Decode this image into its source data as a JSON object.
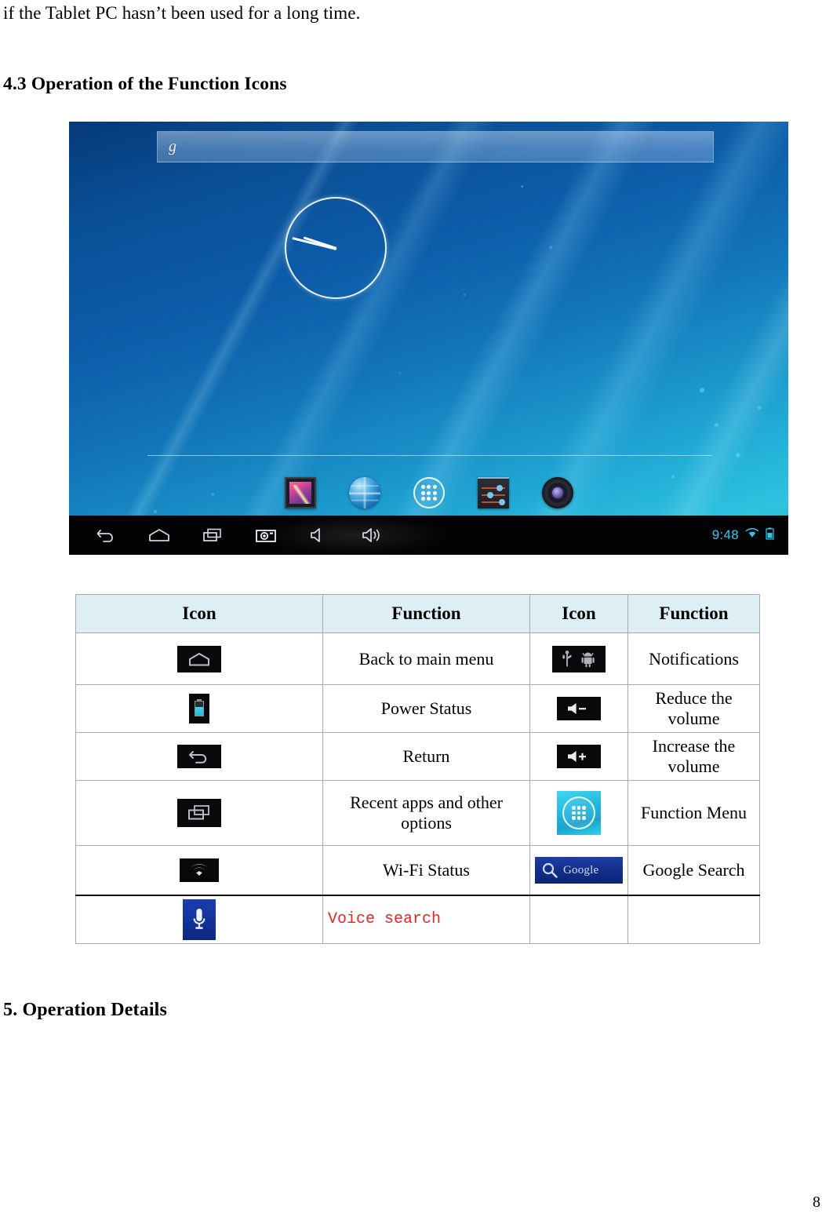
{
  "document": {
    "body_text": "if the Tablet PC hasn’t been used for a long time.",
    "heading_43": "4.3 Operation of the Function Icons",
    "heading_5": "5. Operation Details",
    "page_number": "8"
  },
  "figure": {
    "name": "android-home-screen-screenshot",
    "search_bar": {
      "logo_glyph": "g",
      "value": ""
    },
    "clock_widget": {
      "name": "analog-clock-widget"
    },
    "dock": {
      "items": [
        {
          "icon": "gallery-icon"
        },
        {
          "icon": "browser-icon"
        },
        {
          "icon": "app-drawer-icon"
        },
        {
          "icon": "settings-icon"
        },
        {
          "icon": "music-player-icon"
        }
      ]
    },
    "navbar": {
      "buttons": [
        {
          "icon": "back-icon"
        },
        {
          "icon": "home-icon"
        },
        {
          "icon": "recent-apps-icon"
        },
        {
          "icon": "screenshot-camera-icon"
        },
        {
          "icon": "volume-down-icon"
        },
        {
          "icon": "volume-up-icon"
        }
      ],
      "clock": "9:48",
      "status_icons": [
        {
          "icon": "wifi-icon"
        },
        {
          "icon": "battery-icon"
        }
      ]
    },
    "colors": {
      "wallpaper_deep_blue": "#063a78",
      "wallpaper_cyan": "#2ec3e0",
      "navbar_background": "#030305",
      "clock_text": "#34c8e8"
    }
  },
  "table": {
    "headers": [
      "Icon",
      "Function",
      "Icon",
      "Function"
    ],
    "rows": [
      {
        "icon_a": "home-icon",
        "function_a": "Back to main menu",
        "icon_b": "usb-android-notifications-icon",
        "function_b": "Notifications"
      },
      {
        "icon_a": "battery-icon",
        "function_a": "Power Status",
        "icon_b": "volume-down-icon",
        "function_b": "Reduce the volume"
      },
      {
        "icon_a": "return-icon",
        "function_a": "Return",
        "icon_b": "volume-up-icon",
        "function_b": "Increase the volume"
      },
      {
        "icon_a": "recent-apps-icon",
        "function_a": "Recent apps and other options",
        "icon_b": "app-drawer-icon",
        "function_b": "Function Menu"
      },
      {
        "icon_a": "wifi-icon",
        "function_a": "Wi-Fi Status",
        "icon_b": "google-search-icon",
        "function_b": "Google Search"
      },
      {
        "icon_a": "microphone-icon",
        "function_a": "Voice search",
        "icon_b": "",
        "function_b": ""
      }
    ],
    "colors": {
      "header_background": "#ddeef4",
      "border": "#a9a9a9",
      "voice_search_text": "#e8251f"
    }
  }
}
